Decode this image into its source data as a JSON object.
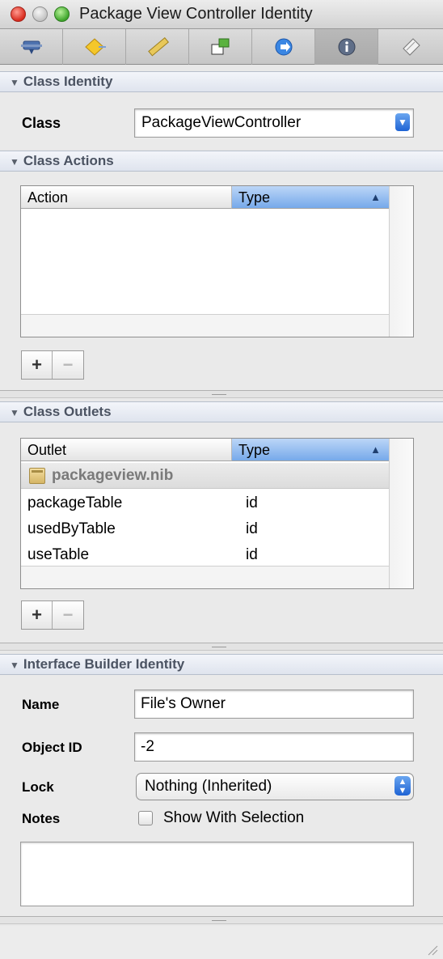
{
  "window": {
    "title": "Package View Controller Identity"
  },
  "toolbar": {
    "tabs": [
      {
        "icon": "attributes-icon"
      },
      {
        "icon": "effects-icon"
      },
      {
        "icon": "size-ruler-icon"
      },
      {
        "icon": "bindings-icon"
      },
      {
        "icon": "connections-icon"
      },
      {
        "icon": "identity-info-icon"
      },
      {
        "icon": "applescript-icon"
      }
    ],
    "selected_index": 5
  },
  "class_identity": {
    "header": "Class Identity",
    "class_label": "Class",
    "class_value": "PackageViewController"
  },
  "class_actions": {
    "header": "Class Actions",
    "columns": [
      "Action",
      "Type"
    ],
    "rows": []
  },
  "class_outlets": {
    "header": "Class Outlets",
    "columns": [
      "Outlet",
      "Type"
    ],
    "group": "packageview.nib",
    "rows": [
      {
        "name": "packageTable",
        "type": "id"
      },
      {
        "name": "usedByTable",
        "type": "id"
      },
      {
        "name": "useTable",
        "type": "id"
      }
    ]
  },
  "buttons": {
    "plus": "+",
    "minus": "−"
  },
  "ib_identity": {
    "header": "Interface Builder Identity",
    "name_label": "Name",
    "name_value": "File's Owner",
    "object_id_label": "Object ID",
    "object_id_value": "-2",
    "lock_label": "Lock",
    "lock_value": "Nothing (Inherited)",
    "notes_label": "Notes",
    "show_with_selection": "Show With Selection",
    "show_with_selection_checked": false
  },
  "colors": {
    "close": "#d82a1d",
    "minimize": "#c3c3c3",
    "zoom": "#3ea52b",
    "sorted_header": "#76a9ea",
    "popup_arrow": "#1e63d4"
  }
}
